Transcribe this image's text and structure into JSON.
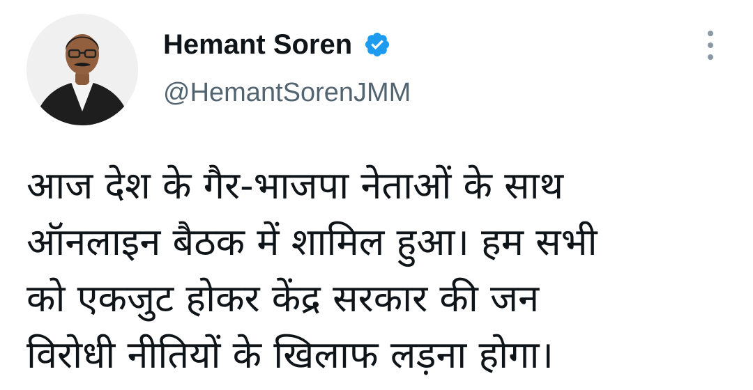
{
  "author": {
    "display_name": "Hemant Soren",
    "handle": "@HemantSorenJMM",
    "verified": true,
    "verified_icon": "verified-badge-icon",
    "avatar_icon": "profile-photo"
  },
  "menu": {
    "icon": "more-options-icon"
  },
  "tweet": {
    "lines": [
      "आज देश के गैर-भाजपा नेताओं के साथ",
      "ऑनलाइन बैठक में शामिल हुआ। हम सभी",
      "को एकजुट होकर केंद्र सरकार की जन",
      "विरोधी नीतियों के खिलाफ लड़ना होगा।"
    ]
  },
  "colors": {
    "text": "#0f1419",
    "secondary_text": "#536471",
    "verified_blue": "#1d9bf0",
    "menu_dots": "#8b98a5"
  }
}
